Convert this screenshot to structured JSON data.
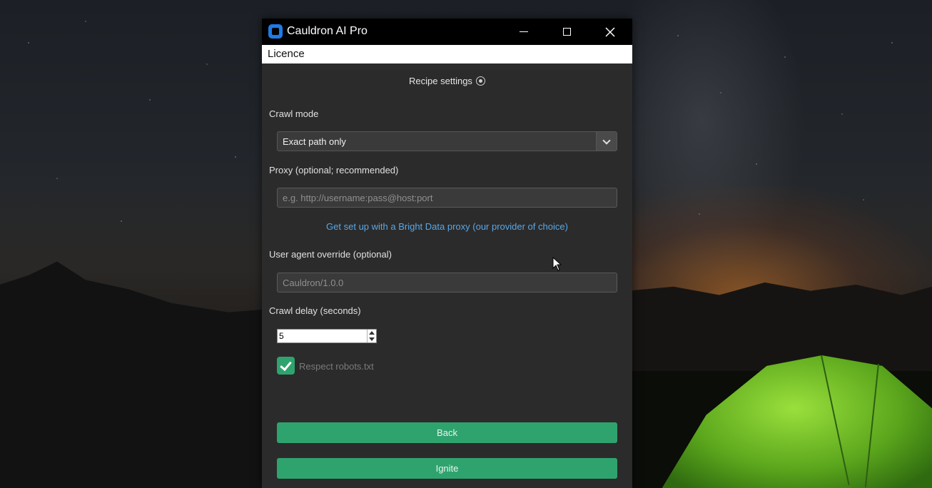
{
  "window": {
    "title": "Cauldron AI Pro",
    "icon": "app-logo-icon",
    "controls": [
      "minimize-icon",
      "maximize-icon",
      "close-icon"
    ]
  },
  "menubar": {
    "items": [
      {
        "label": "Licence"
      }
    ]
  },
  "form": {
    "section_title": "Recipe settings",
    "crawl_mode": {
      "label": "Crawl mode",
      "selected": "Exact path only"
    },
    "proxy": {
      "label": "Proxy (optional; recommended)",
      "placeholder": "e.g. http://username:pass@host:port",
      "value": ""
    },
    "proxy_link": "Get set up with a Bright Data proxy (our provider of choice)",
    "user_agent": {
      "label": "User agent override (optional)",
      "placeholder": "Cauldron/1.0.0",
      "value": ""
    },
    "crawl_delay": {
      "label": "Crawl delay (seconds)",
      "value": "5"
    },
    "robots": {
      "label": "Respect robots.txt",
      "checked": true
    },
    "back_label": "Back",
    "ignite_label": "Ignite"
  },
  "colors": {
    "accent": "#2fa36e",
    "link": "#5aa7e6",
    "panel": "#2b2b2b"
  }
}
